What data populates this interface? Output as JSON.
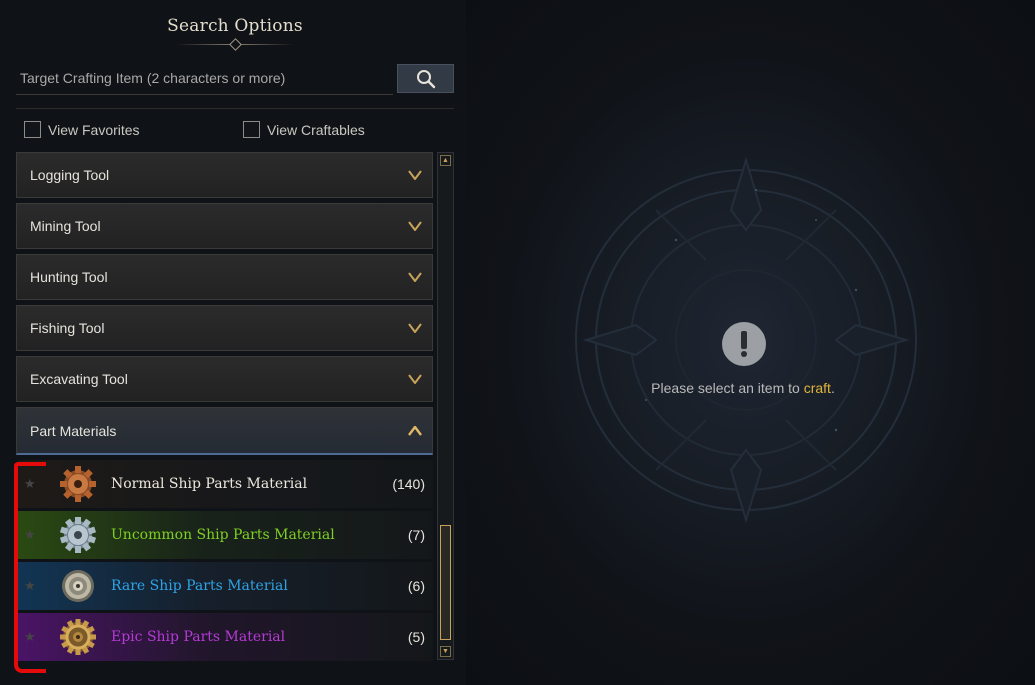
{
  "panel": {
    "title": "Search Options",
    "search": {
      "placeholder": "Target Crafting Item (2 characters or more)",
      "value": ""
    },
    "filters": [
      {
        "label": "View Favorites",
        "checked": false
      },
      {
        "label": "View Craftables",
        "checked": false
      }
    ],
    "categories": [
      {
        "label": "Logging Tool",
        "expanded": false
      },
      {
        "label": "Mining Tool",
        "expanded": false
      },
      {
        "label": "Hunting Tool",
        "expanded": false
      },
      {
        "label": "Fishing Tool",
        "expanded": false
      },
      {
        "label": "Excavating Tool",
        "expanded": false
      },
      {
        "label": "Part Materials",
        "expanded": true
      }
    ],
    "part_materials": [
      {
        "label": "Normal Ship Parts Material",
        "count": "(140)",
        "color": "#ece8df",
        "icon": "bronze-gear-icon"
      },
      {
        "label": "Uncommon Ship Parts Material",
        "count": "(7)",
        "color": "#7fd022",
        "icon": "silver-gear-icon"
      },
      {
        "label": "Rare Ship Parts Material",
        "count": "(6)",
        "color": "#2ea3e6",
        "icon": "steel-disc-gear-icon"
      },
      {
        "label": "Epic Ship Parts Material",
        "count": "(5)",
        "color": "#b63ad6",
        "icon": "gold-gear-icon"
      }
    ]
  },
  "detail": {
    "message_prefix": "Please select an item to ",
    "message_highlight": "craft",
    "message_suffix": "."
  },
  "colors": {
    "accent_gold": "#c8a25a",
    "highlight_yellow": "#e2b43a",
    "annotation_red": "#e60b0b"
  }
}
